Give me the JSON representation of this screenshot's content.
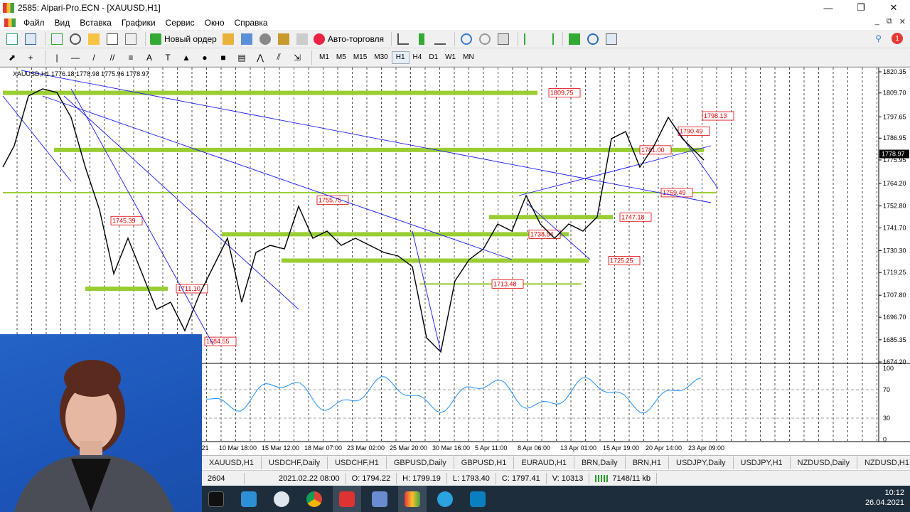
{
  "window": {
    "title": "2585: Alpari-Pro.ECN - [XAUUSD,H1]",
    "minimize": "—",
    "maximize": "❐",
    "close": "✕"
  },
  "menu": [
    "Файл",
    "Вид",
    "Вставка",
    "Графики",
    "Сервис",
    "Окно",
    "Справка"
  ],
  "mdi": {
    "minimize": "_",
    "restore": "⧉",
    "close": "✕"
  },
  "toolbar": {
    "new_order": "Новый ордер",
    "autotrading": "Авто-торговля",
    "notifications": "1"
  },
  "timeframes": [
    "M1",
    "M5",
    "M15",
    "M30",
    "H1",
    "H4",
    "D1",
    "W1",
    "MN"
  ],
  "active_timeframe": "H1",
  "chart": {
    "header": "XAUUSD,H1 1776.18 1778.98 1775.96 1778.97",
    "current_price": "1778.97",
    "price_labels": [
      "1820.35",
      "1809.70",
      "1797.65",
      "1786.95",
      "1775.95",
      "1764.20",
      "1752.80",
      "1741.70",
      "1730.30",
      "1719.25",
      "1707.80",
      "1696.70",
      "1685.35",
      "1674.20"
    ],
    "level_labels": [
      "1809.75",
      "1798.13",
      "1790.49",
      "1781.00",
      "1759.49",
      "1755.75",
      "1747.18",
      "1745.39",
      "1738.54",
      "1725.25",
      "1713.48",
      "1711.10",
      "1684.55"
    ],
    "date_labels": [
      "1 Mar 2021",
      "10 Mar 18:00",
      "15 Mar 12:00",
      "18 Mar 07:00",
      "23 Mar 02:00",
      "25 Mar 20:00",
      "30 Mar 16:00",
      "5 Apr 11:00",
      "8 Apr 06:00",
      "13 Apr 01:00",
      "15 Apr 19:00",
      "20 Apr 14:00",
      "23 Apr 09:00"
    ],
    "rsi_labels": [
      "100",
      "70",
      "30",
      "0"
    ]
  },
  "tabs": [
    "XAUUSD,H1",
    "USDCHF,Daily",
    "USDCHF,H1",
    "GBPUSD,Daily",
    "GBPUSD,H1",
    "EURAUD,H1",
    "BRN,Daily",
    "BRN,H1",
    "USDJPY,Daily",
    "USDJPY,H1",
    "NZDUSD,Daily",
    "NZDUSD,H1",
    "US"
  ],
  "status": {
    "bars": "2604",
    "datetime": "2021.02.22 08:00",
    "open": "O: 1794.22",
    "high": "H: 1799.19",
    "low": "L: 1793.40",
    "close": "C: 1797.41",
    "volume": "V: 10313",
    "traffic": "7148/11 kb"
  },
  "clock": {
    "time": "10:12",
    "date": "26.04.2021"
  },
  "colors": {
    "level_line": "#9acd32",
    "trend_line": "#1a1aff",
    "rsi": "#1e90ff",
    "label_red": "#e00000"
  }
}
